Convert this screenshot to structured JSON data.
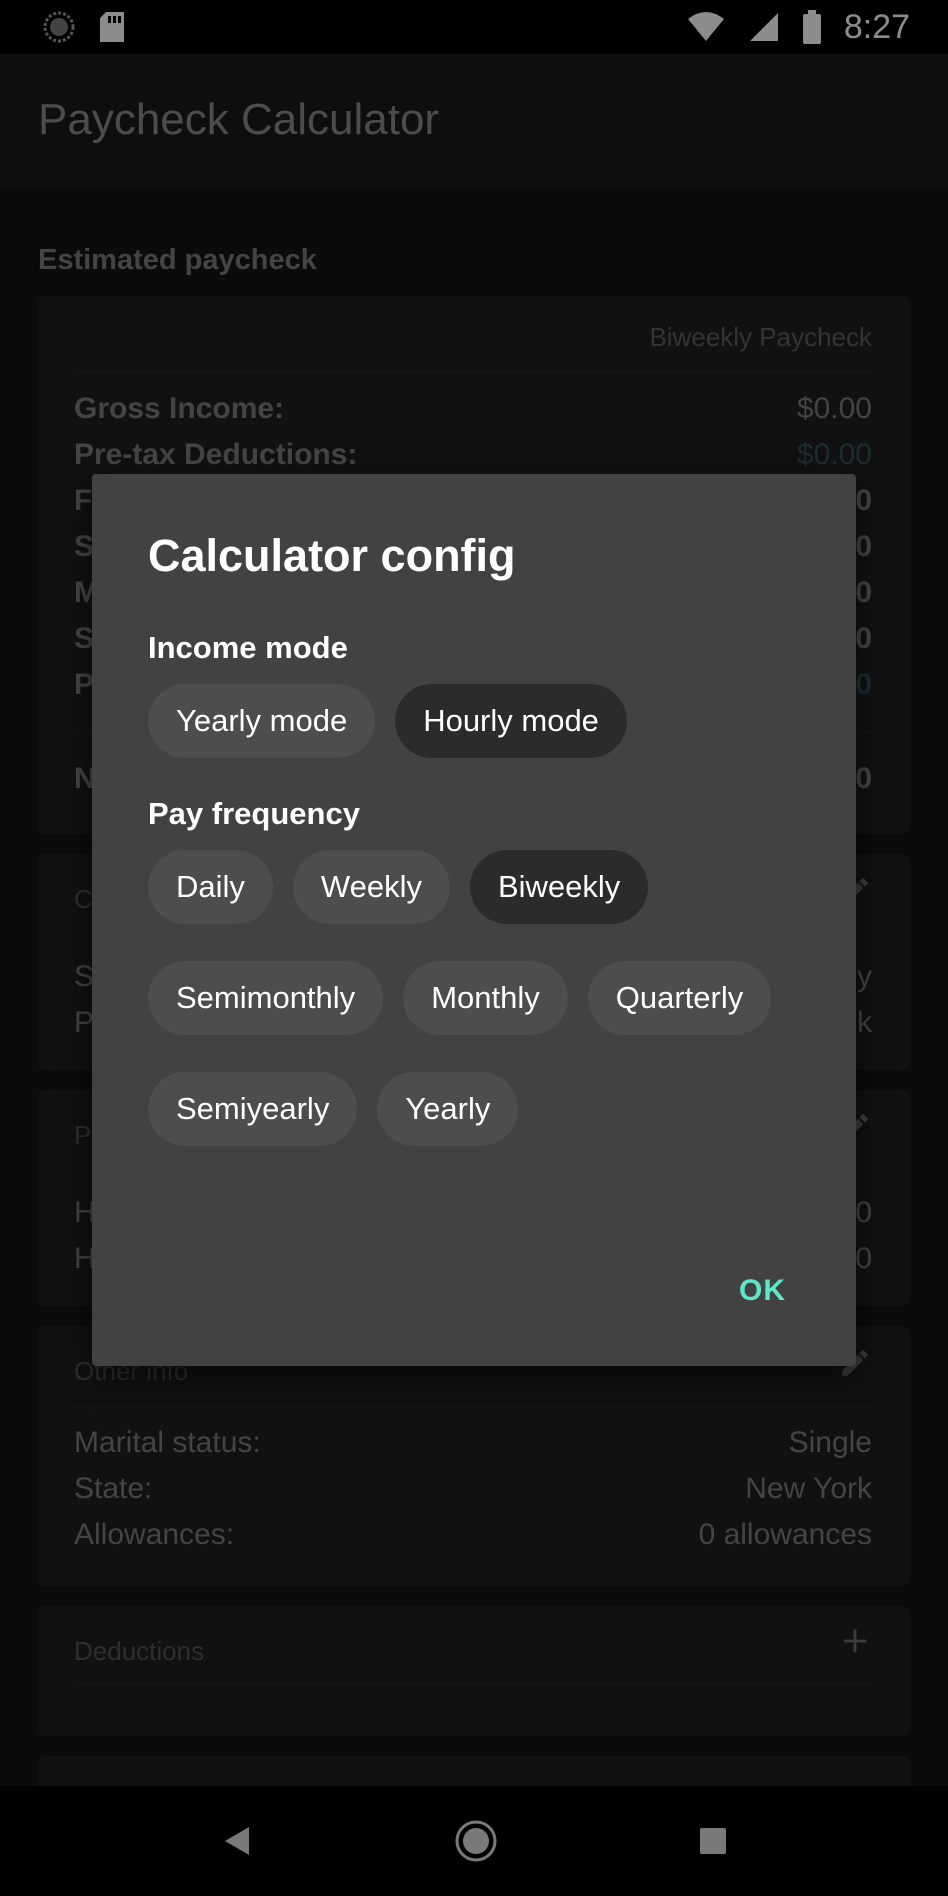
{
  "status_bar": {
    "time": "8:27"
  },
  "app_bar": {
    "title": "Paycheck Calculator"
  },
  "summary": {
    "section_title": "Estimated paycheck",
    "period_label": "Biweekly Paycheck",
    "rows": [
      {
        "label": "Gross Income:",
        "value": "$0.00"
      },
      {
        "label": "Pre-tax Deductions:",
        "value": "$0.00"
      },
      {
        "label": "F",
        "value": "0"
      },
      {
        "label": "S",
        "value": "0"
      },
      {
        "label": "M",
        "value": "0"
      },
      {
        "label": "S",
        "value": "0"
      },
      {
        "label": "P",
        "value": "0"
      }
    ],
    "net_row": {
      "label": "N",
      "value": "0"
    }
  },
  "card2": {
    "label": "C",
    "rows": [
      {
        "label": "S",
        "value": "y"
      },
      {
        "label": "P",
        "value": "k"
      }
    ]
  },
  "card3": {
    "label": "P",
    "rows": [
      {
        "label": "H",
        "value": "0"
      },
      {
        "label": "H",
        "value": "0"
      }
    ]
  },
  "other_info": {
    "label": "Other info",
    "rows": [
      {
        "label": "Marital status:",
        "value": "Single"
      },
      {
        "label": "State:",
        "value": "New York"
      },
      {
        "label": "Allowances:",
        "value": "0 allowances"
      }
    ]
  },
  "deductions": {
    "label": "Deductions"
  },
  "dialog": {
    "title": "Calculator config",
    "income_mode_label": "Income mode",
    "income_modes": [
      {
        "label": "Yearly mode",
        "selected": false
      },
      {
        "label": "Hourly mode",
        "selected": true
      }
    ],
    "pay_frequency_label": "Pay frequency",
    "frequency_row1": [
      {
        "label": "Daily",
        "selected": false
      },
      {
        "label": "Weekly",
        "selected": false
      },
      {
        "label": "Biweekly",
        "selected": true
      }
    ],
    "frequency_row2": [
      {
        "label": "Semimonthly",
        "selected": false
      },
      {
        "label": "Monthly",
        "selected": false
      },
      {
        "label": "Quarterly",
        "selected": false
      }
    ],
    "frequency_row3": [
      {
        "label": "Semiyearly",
        "selected": false
      },
      {
        "label": "Yearly",
        "selected": false
      }
    ],
    "ok_label": "OK"
  },
  "colors": {
    "accent": "#5fe6c8",
    "dialog_bg": "#424242",
    "chip_bg": "#4d4d4d",
    "chip_selected_bg": "#2b2b2b"
  }
}
